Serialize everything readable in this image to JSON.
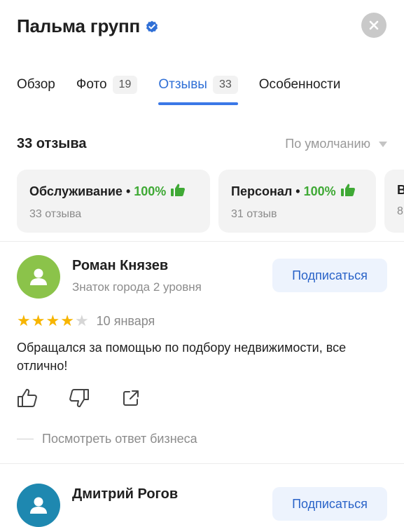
{
  "org": {
    "name": "Пальма групп",
    "verified_icon": "verified-badge-icon",
    "accent": "#2f6fd6"
  },
  "tabs": [
    {
      "label": "Обзор",
      "count": ""
    },
    {
      "label": "Фото",
      "count": "19"
    },
    {
      "label": "Отзывы",
      "count": "33",
      "active": true
    },
    {
      "label": "Особенности",
      "count": ""
    }
  ],
  "reviews_header": {
    "count_label": "33 отзыва",
    "sort_label": "По умолчанию"
  },
  "categories": [
    {
      "name": "Обслуживание",
      "percent": "100%",
      "count": "33 отзыва"
    },
    {
      "name": "Персонал",
      "percent": "100%",
      "count": "31 отзыв"
    },
    {
      "name": "В",
      "percent": "",
      "count": "8"
    }
  ],
  "reviews": [
    {
      "author": "Роман Князев",
      "level": "Знаток города 2 уровня",
      "subscribe_label": "Подписаться",
      "rating": 4,
      "date": "10 января",
      "text": "Обращался за помощью по подбору недвижимости, все отлично!",
      "business_reply_label": "Посмотреть ответ бизнеса",
      "avatar_color": "#8bc34a"
    },
    {
      "author": "Дмитрий Рогов",
      "subscribe_label": "Подписаться",
      "avatar_color": "#1e88b0"
    }
  ],
  "colors": {
    "star_on": "#f7b500",
    "star_off": "#d6d6d6",
    "positive": "#3fa935"
  }
}
